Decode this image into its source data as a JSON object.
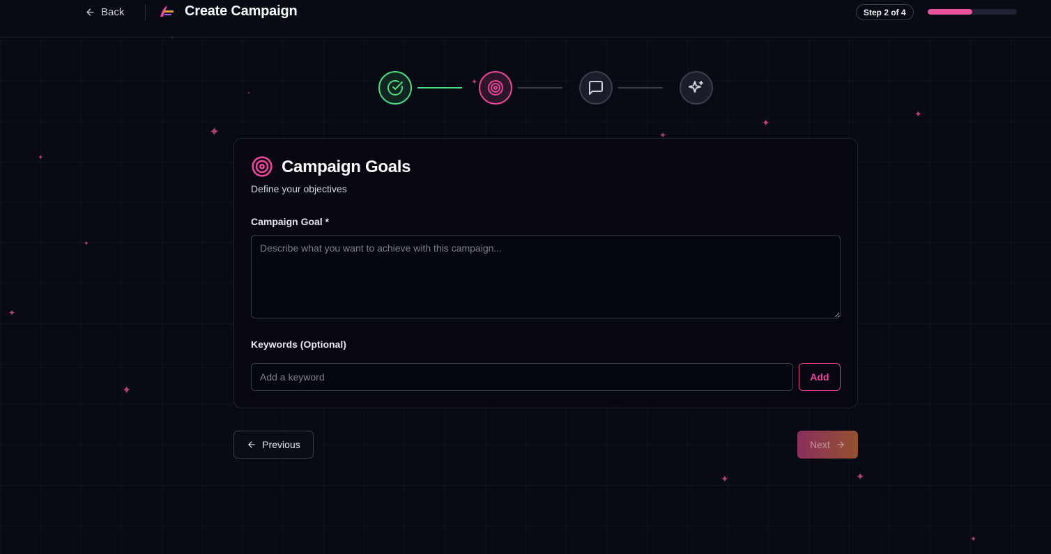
{
  "header": {
    "back_label": "Back",
    "title": "Create Campaign",
    "step_badge": "Step 2 of 4",
    "progress_percent": 50
  },
  "stepper": {
    "steps": [
      {
        "status": "completed",
        "icon": "check-circle-icon"
      },
      {
        "status": "active",
        "icon": "target-icon"
      },
      {
        "status": "pending",
        "icon": "message-square-icon"
      },
      {
        "status": "pending",
        "icon": "sparkles-icon"
      }
    ]
  },
  "card": {
    "icon": "target-icon",
    "title": "Campaign Goals",
    "subtitle": "Define your objectives",
    "goal_label": "Campaign Goal *",
    "goal_value": "",
    "goal_placeholder": "Describe what you want to achieve with this campaign...",
    "keywords_label": "Keywords (Optional)",
    "keyword_value": "",
    "keyword_placeholder": "Add a keyword",
    "add_label": "Add"
  },
  "footer": {
    "previous_label": "Previous",
    "next_label": "Next"
  },
  "colors": {
    "background": "#080b14",
    "accent_pink": "#ec4899",
    "success_green": "#4ade80",
    "border": "#3a3f4c"
  }
}
